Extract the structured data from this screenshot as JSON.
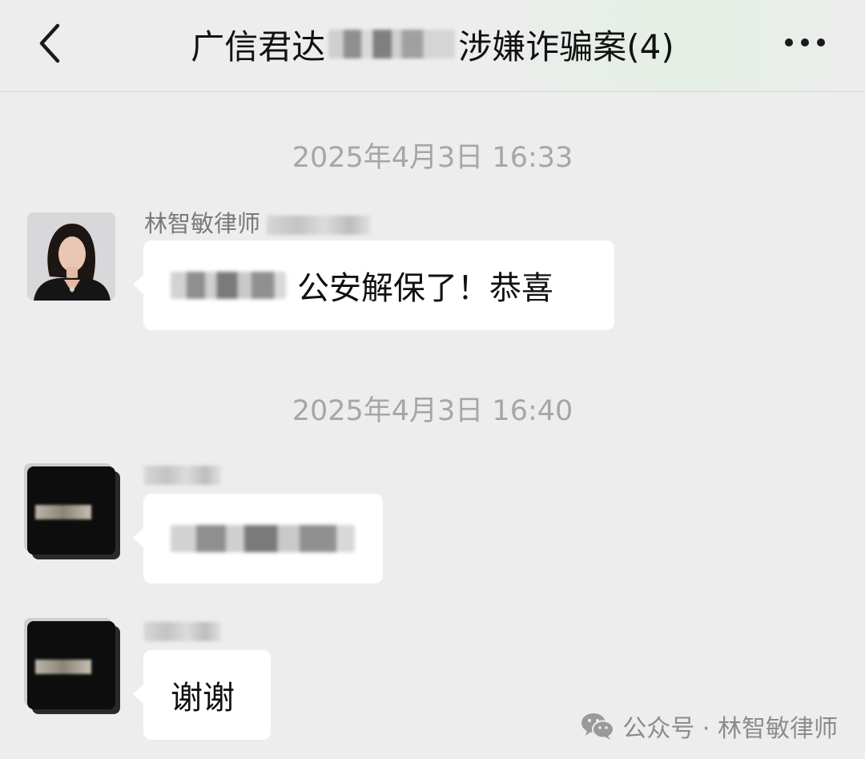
{
  "header": {
    "title_prefix": "广信君达",
    "title_suffix": "涉嫌诈骗案(4)"
  },
  "messages": [
    {
      "timestamp": "2025年4月3日 16:33",
      "sender": "林智敏律师",
      "text": "公安解保了！恭喜"
    },
    {
      "timestamp": "2025年4月3日 16:40",
      "sender": "",
      "text": ""
    },
    {
      "timestamp": "",
      "sender": "",
      "text": "谢谢"
    }
  ],
  "watermark": {
    "text": "公众号 · 林智敏律师"
  },
  "colors": {
    "background": "#ededed",
    "bubble": "#ffffff",
    "timestamp": "#a6a6a6",
    "sender": "#7a7a7a"
  }
}
